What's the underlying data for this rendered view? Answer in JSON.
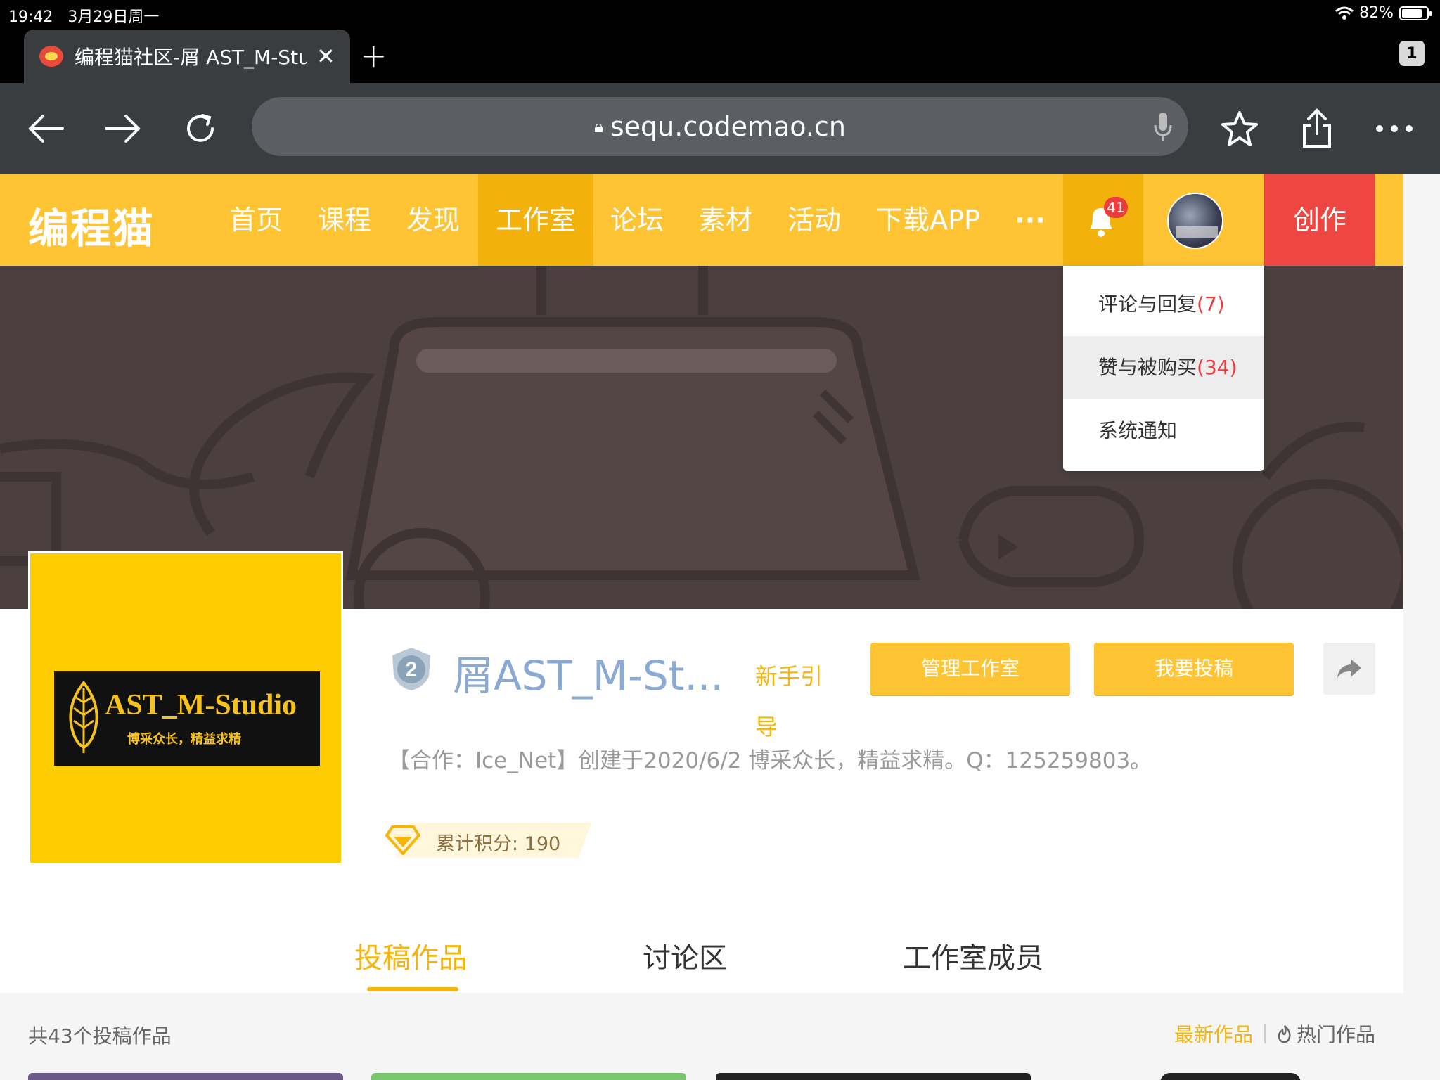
{
  "status": {
    "time": "19:42",
    "date": "3月29日周一",
    "battery": "82%",
    "battery_level": 0.82
  },
  "browser": {
    "tab_title": "编程猫社区-屑 AST_M-Studio",
    "tab_close": "✕",
    "new_tab": "+",
    "tab_count": "1",
    "url": "sequ.codemao.cn"
  },
  "site": {
    "logo": "编程猫",
    "nav": [
      "首页",
      "课程",
      "发现",
      "工作室",
      "论坛",
      "素材",
      "活动",
      "下载APP",
      "···"
    ],
    "active_nav": "工作室",
    "notification_count": "41",
    "create": "创作"
  },
  "dropdown": {
    "items": [
      {
        "label": "评论与回复",
        "count": "(7)"
      },
      {
        "label": "赞与被购买",
        "count": "(34)"
      },
      {
        "label": "系统通知",
        "count": ""
      }
    ]
  },
  "studio": {
    "cover_title": "AST_M-Studio",
    "cover_subtitle": "博采众长，精益求精",
    "level": "2",
    "name": "屑AST_M-St...",
    "guide": "新手引导",
    "manage_button": "管理工作室",
    "submit_button": "我要投稿",
    "description": "【合作：Ice_Net】创建于2020/6/2 博采众长，精益求精。Q：125259803。",
    "points": "累计积分: 190"
  },
  "tabs": [
    "投稿作品",
    "讨论区",
    "工作室成员"
  ],
  "works": {
    "total": "共43个投稿作品",
    "sort_newest": "最新作品",
    "sort_hot": "热门作品"
  },
  "colors": {
    "brand_yellow": "#fec433",
    "active_yellow": "#f3b10c",
    "create_red": "#ee4742",
    "accent_orange": "#f5b50a"
  }
}
